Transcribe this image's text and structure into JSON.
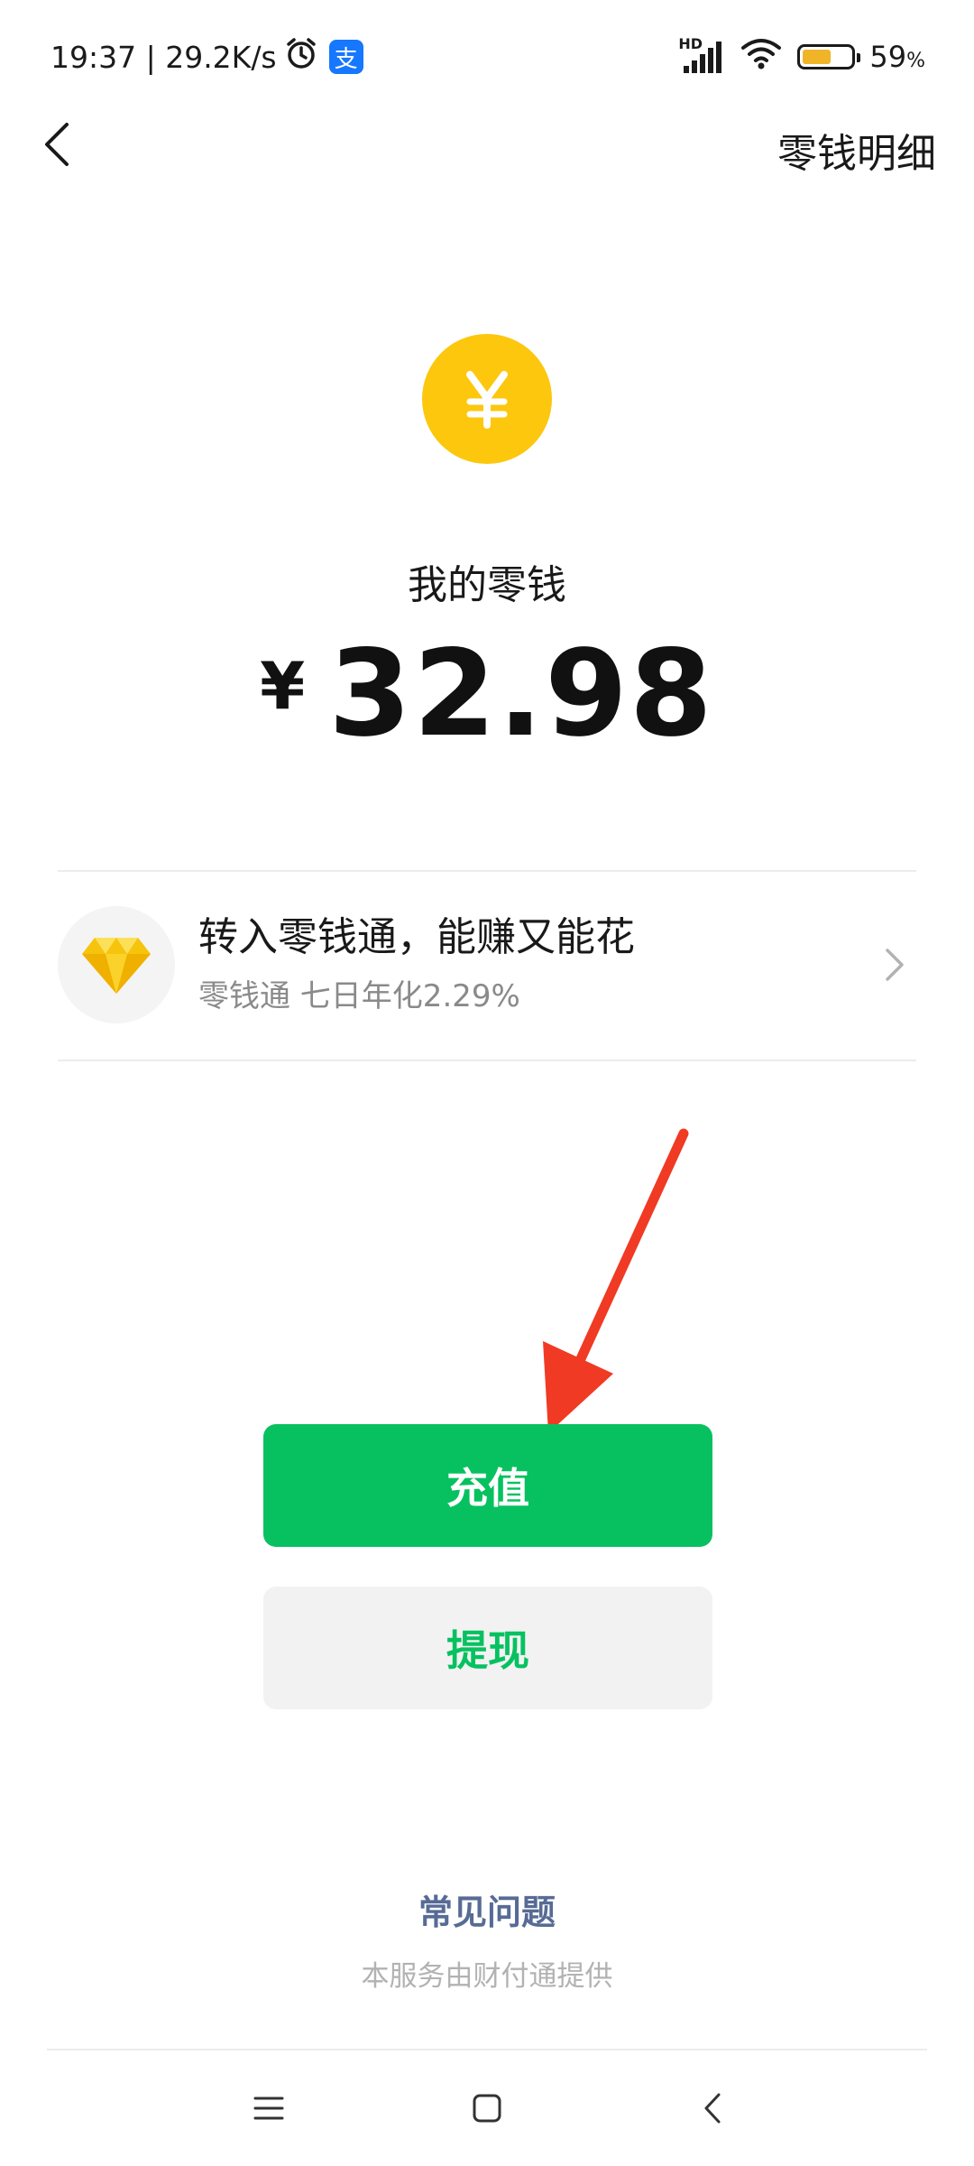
{
  "status_bar": {
    "time_speed": "19:37 | 29.2K/s",
    "alipay_glyph": "支",
    "network_label": "HD",
    "battery_level": 0.59,
    "battery_value": "59",
    "battery_unit": "%",
    "battery_color": "#f0b429"
  },
  "nav": {
    "back_icon": "chevron-left-icon",
    "right_link": "零钱明细"
  },
  "wallet": {
    "coin_icon": "yuan-coin-icon",
    "coin_color": "#fcc70d",
    "label": "我的零钱",
    "currency": "¥",
    "balance": "32.98"
  },
  "promo": {
    "icon": "diamond-icon",
    "title": "转入零钱通，能赚又能花",
    "subtitle": "零钱通 七日年化2.29%"
  },
  "actions": {
    "recharge_label": "充值",
    "withdraw_label": "提现",
    "accent_color": "#07c160"
  },
  "footer": {
    "faq_label": "常见问题",
    "provider_text": "本服务由财付通提供",
    "link_color": "#576b95"
  },
  "system_nav": {
    "menu_icon": "menu-icon",
    "home_icon": "home-square-icon",
    "back_icon": "back-triangle-icon"
  }
}
